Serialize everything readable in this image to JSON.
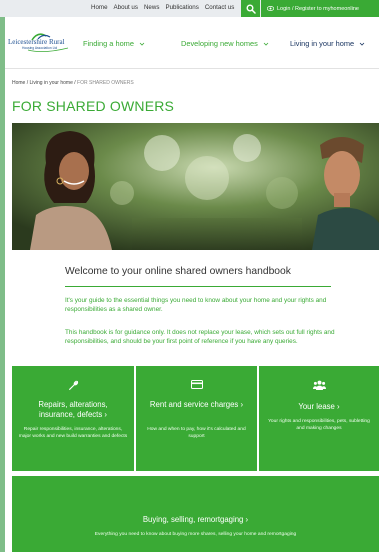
{
  "colors": {
    "brand_green": "#3aaa35",
    "navy": "#1a3561",
    "topbar_bg": "#e9ecef"
  },
  "topbar": {
    "links": [
      "Home",
      "About us",
      "News",
      "Publications",
      "Contact us"
    ],
    "search_icon": "search-icon",
    "login_label": "Login / Register to myhomeonline",
    "login_icon": "eye-icon"
  },
  "header": {
    "logo_text": "Leicestershire Rural",
    "logo_sub": "Housing Association Ltd",
    "nav": [
      {
        "label": "Finding a home"
      },
      {
        "label": "Developing new homes"
      },
      {
        "label": "Living in your home"
      }
    ],
    "chevron_icon": "chevron-down-icon"
  },
  "breadcrumb": {
    "home": "Home",
    "sep": "/",
    "parent": "Living in your home",
    "current": "FOR SHARED OWNERS"
  },
  "page_title": "FOR SHARED OWNERS",
  "hero_image": "photo-two-people-talking-outdoors",
  "welcome": {
    "heading": "Welcome to your online shared owners handbook",
    "para1": "It's your guide to the essential things you need to know about your home and your rights and responsibilities as a shared owner.",
    "para2": "This handbook is for guidance only. It does not replace your lease, which sets out full rights and responsibilities, and should be your first point of reference if you have any queries."
  },
  "cards": [
    {
      "icon": "wrench-icon",
      "title": "Repairs, alterations, insurance, defects ›",
      "desc": "Repair responsibilities, insurance, alterations, major works and new build warranties and defects"
    },
    {
      "icon": "credit-card-icon",
      "title": "Rent and service charges ›",
      "desc": "How and when to pay, how it's calculated and support"
    },
    {
      "icon": "users-icon",
      "title": "Your lease ›",
      "desc": "Your rights and responsibilities, pets, subletting and making changes"
    },
    {
      "icon": "",
      "title": "Buying, selling, remortgaging ›",
      "desc": "Everything you need to know about buying more shares, selling your home and remortgaging"
    }
  ]
}
